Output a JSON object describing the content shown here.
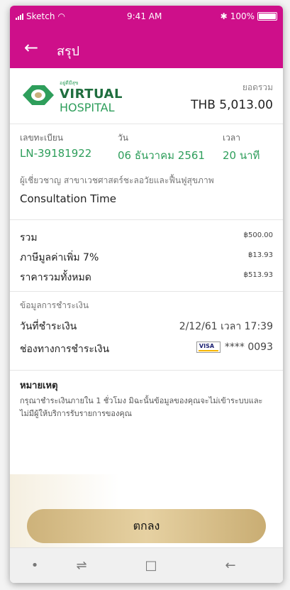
{
  "status": {
    "carrier": "Sketch",
    "time": "9:41 AM",
    "battery": "100%"
  },
  "nav": {
    "title": "สรุป"
  },
  "header": {
    "logo_small": "อยู่ดีมีสุข",
    "logo_virtual": "VIRTUAL",
    "logo_hospital": "HOSPITAL",
    "total_label": "ยอดรวม",
    "total_value": "THB 5,013.00"
  },
  "info": {
    "reg_label": "เลขทะเบียน",
    "reg_value": "LN-39181922",
    "date_label": "วัน",
    "date_value": "06 ธันวาคม 2561",
    "time_label": "เวลา",
    "time_value": "20 นาที"
  },
  "specialist": {
    "label": "ผู้เชี่ยวชาญ สาขาเวชศาสตร์ชะลอวัยและฟื้นฟูสุขภาพ",
    "value": "Consultation Time"
  },
  "summary": {
    "rows": [
      {
        "label": "รวม",
        "amount": "฿500.00"
      },
      {
        "label": "ภาษีมูลค่าเพิ่ม 7%",
        "amount": "฿13.93"
      },
      {
        "label": "ราคารวมทั้งหมด",
        "amount": "฿513.93"
      }
    ]
  },
  "payment": {
    "title": "ข้อมูลการชำระเงิน",
    "date_label": "วันที่ชำระเงิน",
    "date_value": "2/12/61 เวลา 17:39",
    "channel_label": "ช่องทางการชำระเงิน",
    "card_brand": "VISA",
    "card_number": "**** 0093"
  },
  "note": {
    "title": "หมายเหตุ",
    "text": "กรุณาชำระเงินภายใน 1 ชั่วโมง มิฉะนั้นข้อมูลของคุณจะไม่เข้าระบบและไม่มีผู้ให้บริการรับรายการของคุณ"
  },
  "button": {
    "ok_label": "ตกลง"
  },
  "colors": {
    "primary": "#ce0f8a",
    "green": "#2e9e5b",
    "gold": "#d8be86"
  }
}
